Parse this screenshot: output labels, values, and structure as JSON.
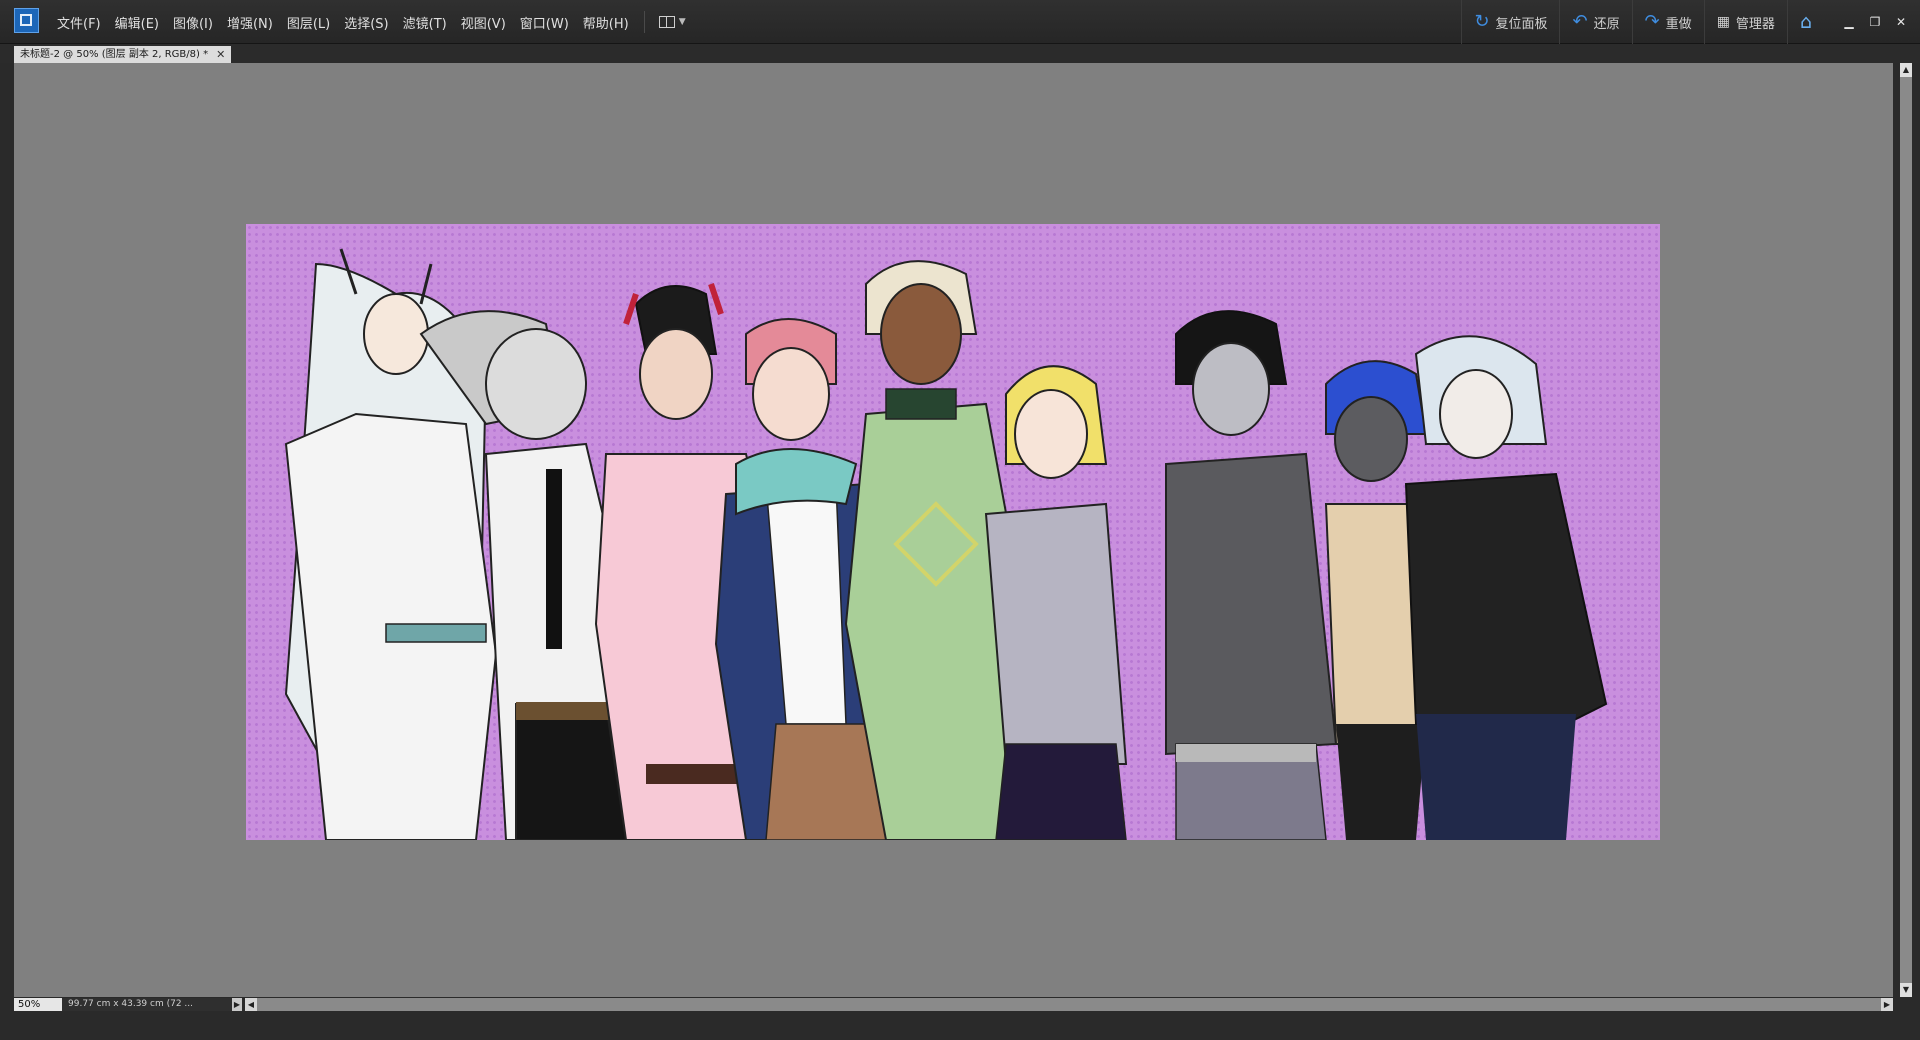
{
  "menubar": {
    "items": [
      "文件(F)",
      "编辑(E)",
      "图像(I)",
      "增强(N)",
      "图层(L)",
      "选择(S)",
      "滤镜(T)",
      "视图(V)",
      "窗口(W)",
      "帮助(H)"
    ],
    "reset_panels": "复位面板",
    "undo": "还原",
    "redo": "重做",
    "manager": "管理器",
    "icons": {
      "reset": "refresh-icon",
      "undo": "undo-icon",
      "redo": "redo-icon",
      "manager": "grid-icon",
      "home": "home-icon",
      "layout": "layout-icon"
    }
  },
  "document_tab": {
    "title": "未标题-2 @ 50% (图层 副本 2, RGB/8) *",
    "close": "✕"
  },
  "status": {
    "zoom": "50%",
    "doc_size": "99.77 cm x 43.39 cm (72 ..."
  },
  "colors": {
    "canvas_bg": "#c98fde",
    "workspace_bg": "#808080",
    "accent": "#3f8de0"
  }
}
